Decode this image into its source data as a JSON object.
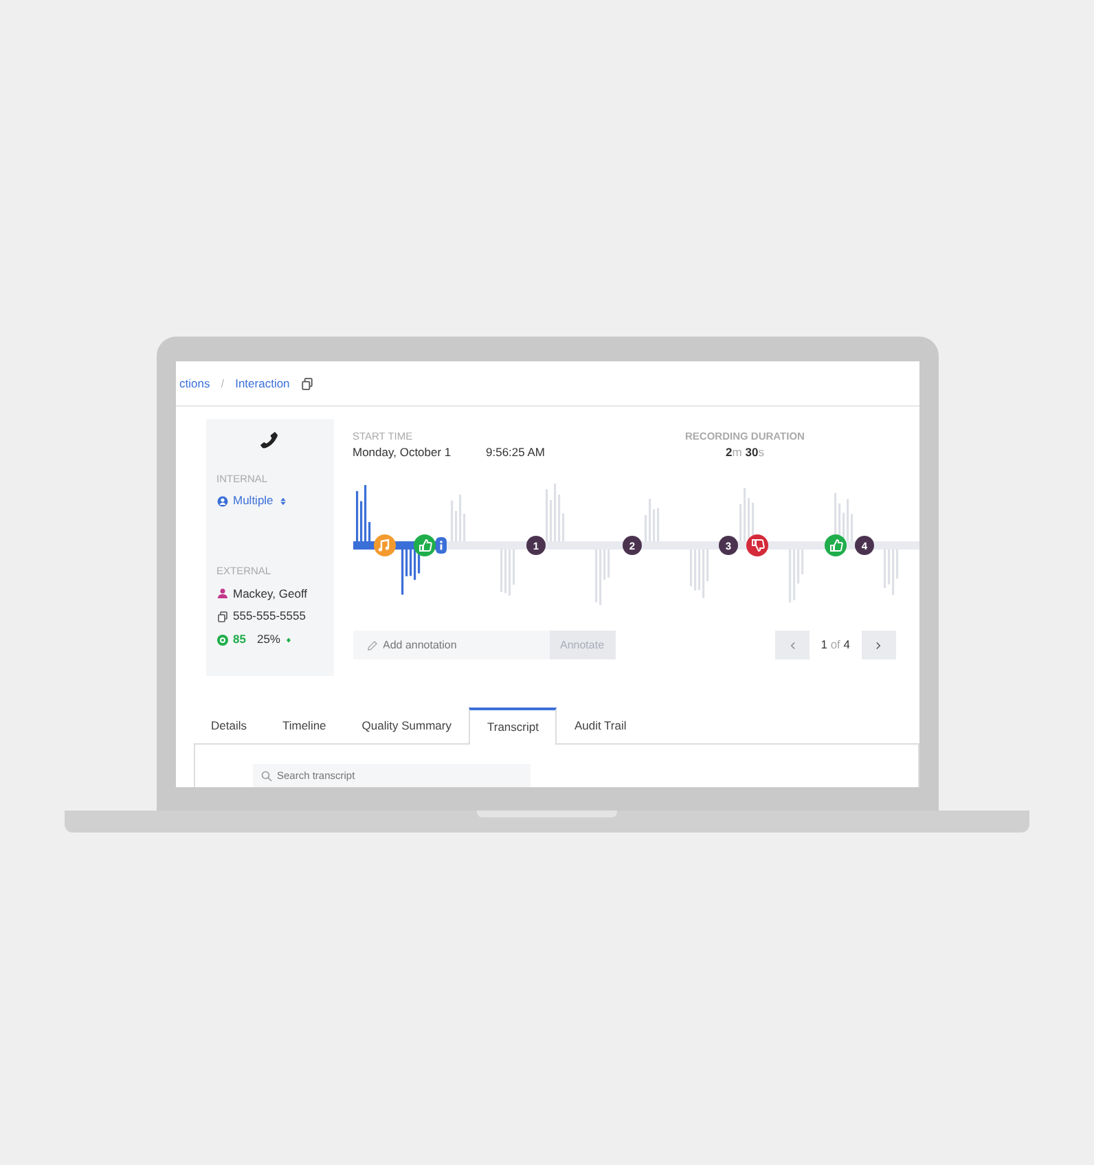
{
  "breadcrumb": {
    "items": [
      "ctions",
      "Interaction"
    ],
    "separator": "/"
  },
  "contact": {
    "internal_label": "INTERNAL",
    "internal_value": "Multiple",
    "external_label": "EXTERNAL",
    "name": "Mackey, Geoff",
    "phone": "555-555-5555",
    "score": "85",
    "percent": "25%"
  },
  "recording": {
    "start_label": "START TIME",
    "start_date": "Monday, October 1",
    "start_time": "9:56:25 AM",
    "duration_label": "RECORDING DURATION",
    "duration": [
      {
        "value": "2",
        "unit": "m"
      },
      {
        "value": "30",
        "unit": "s"
      }
    ]
  },
  "waveform": {
    "level": 0.16
  },
  "markers": [
    {
      "kind": "music",
      "color": "#f39a2e"
    },
    {
      "kind": "thumbs-up",
      "color": "#1fae4b"
    },
    {
      "kind": "info",
      "color": "#3b6fd8"
    },
    {
      "kind": "number",
      "label": "1",
      "color": "#4b3350"
    },
    {
      "kind": "number",
      "label": "2",
      "color": "#4b3350"
    },
    {
      "kind": "number",
      "label": "3",
      "color": "#4b3350"
    },
    {
      "kind": "thumbs-down",
      "color": "#d42a3a"
    },
    {
      "kind": "thumbs-up",
      "color": "#1fae4b"
    },
    {
      "kind": "number",
      "label": "4",
      "color": "#4b3350"
    }
  ],
  "annotation": {
    "placeholder": "Add annotation",
    "button": "Annotate",
    "button_disabled": true
  },
  "pager": {
    "current": "1",
    "of": "of",
    "total": "4"
  },
  "tabs": [
    {
      "label": "Details",
      "selected": false
    },
    {
      "label": "Timeline",
      "selected": false
    },
    {
      "label": "Quality Summary",
      "selected": false
    },
    {
      "label": "Transcript",
      "selected": true
    },
    {
      "label": "Audit Trail",
      "selected": false
    }
  ],
  "search": {
    "placeholder": "Search transcript"
  }
}
